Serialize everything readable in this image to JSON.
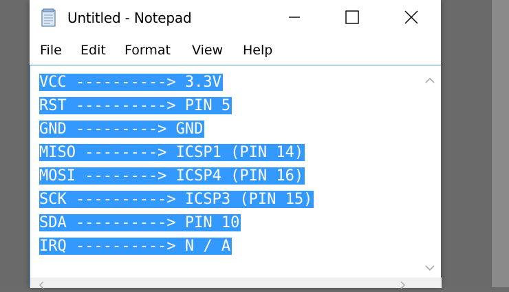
{
  "window": {
    "title": "Untitled - Notepad",
    "app_icon": "notepad-icon"
  },
  "caption_buttons": {
    "minimize_icon": "minimize-icon",
    "maximize_icon": "maximize-icon",
    "close_icon": "close-icon"
  },
  "menu": {
    "items": [
      {
        "label": "File"
      },
      {
        "label": "Edit"
      },
      {
        "label": "Format"
      },
      {
        "label": "View"
      },
      {
        "label": "Help"
      }
    ]
  },
  "editor": {
    "selection_color": "#3399ff",
    "lines": [
      "VCC ----------> 3.3V",
      "RST ----------> PIN 5",
      "GND ---------> GND",
      "MISO --------> ICSP1 (PIN 14)",
      "MOSI --------> ICSP4 (PIN 16)",
      "SCK ----------> ICSP3 (PIN 15)",
      "SDA ----------> PIN 10",
      "IRQ ----------> N / A"
    ]
  },
  "scrollbars": {
    "up_icon": "chevron-up-icon",
    "down_icon": "chevron-down-icon"
  }
}
